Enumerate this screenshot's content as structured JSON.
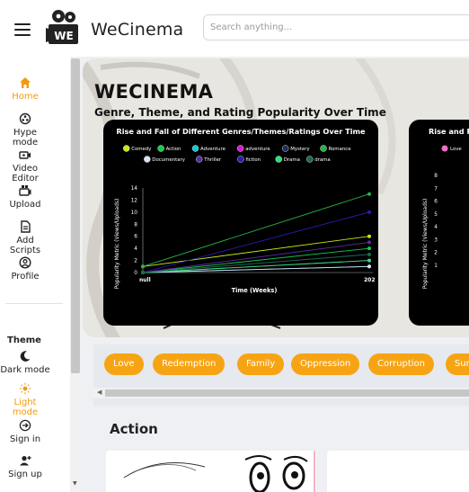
{
  "header": {
    "brand": "WeCinema",
    "logo_text": "WE",
    "search_placeholder": "Search anything..."
  },
  "sidebar": {
    "items": [
      {
        "label": "Home",
        "icon": "home-icon",
        "active": true
      },
      {
        "label": "Hype mode",
        "icon": "hype-icon"
      },
      {
        "label": "Video Editor",
        "icon": "video-editor-icon"
      },
      {
        "label": "Upload",
        "icon": "upload-icon"
      },
      {
        "label": "Add Scripts",
        "icon": "document-icon"
      },
      {
        "label": "Profile",
        "icon": "user-circle-icon"
      }
    ],
    "theme_title": "Theme",
    "theme_items": [
      {
        "label": "Dark mode",
        "icon": "moon-icon"
      },
      {
        "label": "Light mode",
        "icon": "sun-icon",
        "active": true
      }
    ],
    "auth_items": [
      {
        "label": "Sign in",
        "icon": "sign-in-icon"
      },
      {
        "label": "Sign up",
        "icon": "add-user-icon"
      }
    ]
  },
  "hero": {
    "title": "WECINEMA",
    "subtitle": "Genre, Theme, and Rating Popularity Over Time"
  },
  "chart_data": [
    {
      "type": "line",
      "title": "Rise and Fall of Different Genres/Themes/Ratings Over Time",
      "xlabel": "Time (Weeks)",
      "ylabel": "Popularity Metric (Views/Uploads)",
      "x": [
        "null",
        "202"
      ],
      "ylim": [
        0,
        14
      ],
      "yticks": [
        0,
        2,
        4,
        6,
        8,
        10,
        12,
        14
      ],
      "legend_position": "top",
      "series": [
        {
          "name": "Comedy",
          "color": "#c6e817",
          "values": [
            1,
            6
          ]
        },
        {
          "name": "Action",
          "color": "#19c94e",
          "values": [
            0,
            4
          ]
        },
        {
          "name": "Adventure",
          "color": "#17c7d1",
          "values": [
            0,
            1
          ]
        },
        {
          "name": "adventure",
          "color": "#d61ad1",
          "values": [
            0,
            2
          ]
        },
        {
          "name": "Mystery",
          "color": "#1f2f5a",
          "values": [
            0,
            3
          ]
        },
        {
          "name": "Romance",
          "color": "#28b24a",
          "values": [
            1,
            13
          ]
        },
        {
          "name": "Documentary",
          "color": "#d9dff5",
          "values": [
            0,
            1
          ]
        },
        {
          "name": "Thriller",
          "color": "#5b2da6",
          "values": [
            0,
            5
          ]
        },
        {
          "name": "fiction",
          "color": "#2d1bb3",
          "values": [
            0,
            10
          ]
        },
        {
          "name": "Drama",
          "color": "#2de07a",
          "values": [
            0,
            2
          ]
        },
        {
          "name": "drama",
          "color": "#1b6b4a",
          "values": [
            0,
            3
          ]
        }
      ]
    },
    {
      "type": "line",
      "title": "Rise and F",
      "ylabel": "Popularity Metric (Views/Uploads)",
      "yticks": [
        1,
        2,
        3,
        4,
        5,
        6,
        7,
        8
      ],
      "series": [
        {
          "name": "Love",
          "color": "#f06fc2",
          "values": []
        }
      ]
    }
  ],
  "tags": [
    "Love",
    "Redemption",
    "Family",
    "Oppression",
    "Corruption",
    "Sur"
  ],
  "section": {
    "title": "Action"
  },
  "colors": {
    "accent": "#f7a414",
    "active_nav": "#f29b0a"
  }
}
